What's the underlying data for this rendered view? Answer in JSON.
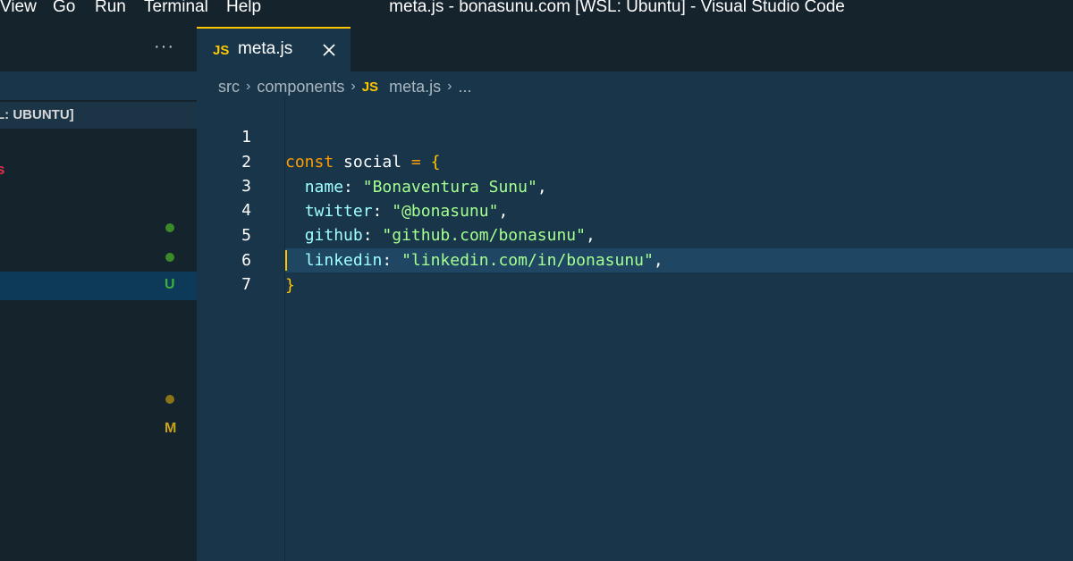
{
  "menu": [
    "View",
    "Go",
    "Run",
    "Terminal",
    "Help"
  ],
  "window_title": "meta.js - bonasunu.com [WSL: Ubuntu] - Visual Studio Code",
  "sidebar": {
    "more_label": "···",
    "section_title": "L: UBUNTU]",
    "red_glyph": "s",
    "badges": [
      {
        "letter": "U",
        "color": "#3bb13b"
      },
      {
        "letter": "M",
        "color": "#c9a21a"
      }
    ],
    "dot_colors": [
      "#3b8a27",
      "#3b8a27",
      "#8a7417"
    ]
  },
  "tab": {
    "icon": "JS",
    "label": "meta.js",
    "close_icon": "close-icon"
  },
  "breadcrumb": {
    "parts": [
      "src",
      "components"
    ],
    "file_icon": "JS",
    "file": "meta.js",
    "more": "..."
  },
  "editor": {
    "line_numbers": [
      "1",
      "2",
      "3",
      "4",
      "5",
      "6",
      "7"
    ],
    "lines": {
      "l1": {
        "kw": "const",
        "id": "social",
        "op": "=",
        "br": "{"
      },
      "l2": {
        "key": "name",
        "str": "\"Bonaventura Sunu\""
      },
      "l3": {
        "key": "twitter",
        "str": "\"@bonasunu\""
      },
      "l4": {
        "key": "github",
        "str": "\"github.com/bonasunu\""
      },
      "l5": {
        "key": "linkedin",
        "str": "\"linkedin.com/in/bonasunu\""
      },
      "l6": {
        "br": "}"
      }
    }
  },
  "colors": {
    "background": "#193549",
    "sidebar": "#15232d",
    "accent": "#ffc600",
    "keyword": "#ff9d00",
    "string": "#a5ff90",
    "property": "#9effff"
  }
}
